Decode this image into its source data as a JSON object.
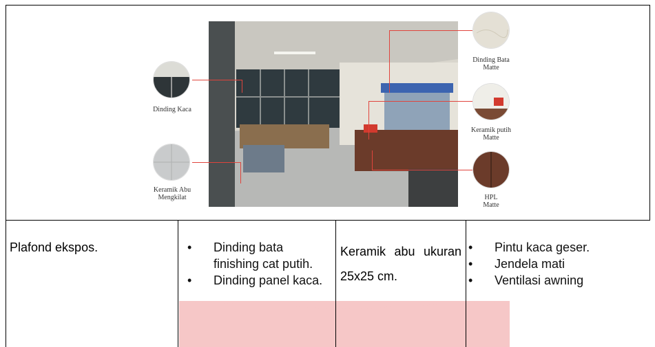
{
  "figure": {
    "labels": {
      "dinding_kaca": "Dinding Kaca",
      "keramik_abu": "Keramik Abu\nMengkilat",
      "dinding_bata": "Dinding Bata\nMatte",
      "keramik_putih": "Keramik putih\nMatte",
      "hpl": "HPL\nMatte"
    },
    "accent_color": "#e0443c"
  },
  "row": {
    "col1_text": "Plafond ekspos.",
    "col2_items": [
      "Dinding bata finishing cat putih.",
      "Dinding panel kaca."
    ],
    "col3_text": "Keramik abu ukuran 25x25 cm.",
    "col4_items": [
      "Pintu kaca geser.",
      "Jendela mati",
      "Ventilasi awning"
    ]
  },
  "bullet_glyph": "•"
}
